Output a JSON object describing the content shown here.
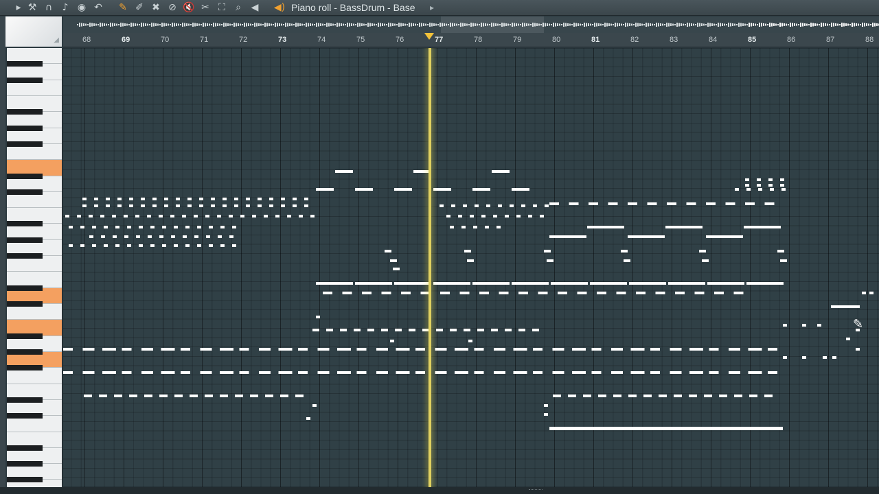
{
  "window": {
    "title": "Piano roll - BassDrum - Base"
  },
  "toolbar": {
    "icons": [
      {
        "name": "play-arrow-icon",
        "glyph": "▸"
      },
      {
        "name": "wrench-icon",
        "glyph": "⚒"
      },
      {
        "name": "magnet-icon",
        "glyph": "∩"
      },
      {
        "name": "note-icon",
        "glyph": "♪"
      },
      {
        "name": "record-icon",
        "glyph": "◉"
      },
      {
        "name": "undo-icon",
        "glyph": "↶"
      },
      {
        "name": "pencil-icon",
        "glyph": "✎"
      },
      {
        "name": "brush-icon",
        "glyph": "✐"
      },
      {
        "name": "delete-icon",
        "glyph": "✖"
      },
      {
        "name": "disable-icon",
        "glyph": "⊘"
      },
      {
        "name": "mute-icon",
        "glyph": "🔇"
      },
      {
        "name": "slice-icon",
        "glyph": "✂"
      },
      {
        "name": "select-icon",
        "glyph": "⛶"
      },
      {
        "name": "zoom-icon",
        "glyph": "⌕"
      },
      {
        "name": "playback-icon",
        "glyph": "◀"
      },
      {
        "name": "speaker-icon",
        "glyph": "◀)"
      }
    ]
  },
  "ruler": {
    "bars": [
      "68",
      "69",
      "70",
      "71",
      "72",
      "73",
      "74",
      "75",
      "76",
      "77",
      "78",
      "79",
      "80",
      "81",
      "82",
      "83",
      "84",
      "85",
      "86",
      "87",
      "88"
    ],
    "major_bars": [
      "69",
      "73",
      "77",
      "81",
      "85"
    ]
  },
  "playhead": {
    "bar": 77
  },
  "colors": {
    "grid_bg": "#304046",
    "note": "#ffffff",
    "playhead": "#e0d060",
    "highlight_key": "#f4a060"
  }
}
